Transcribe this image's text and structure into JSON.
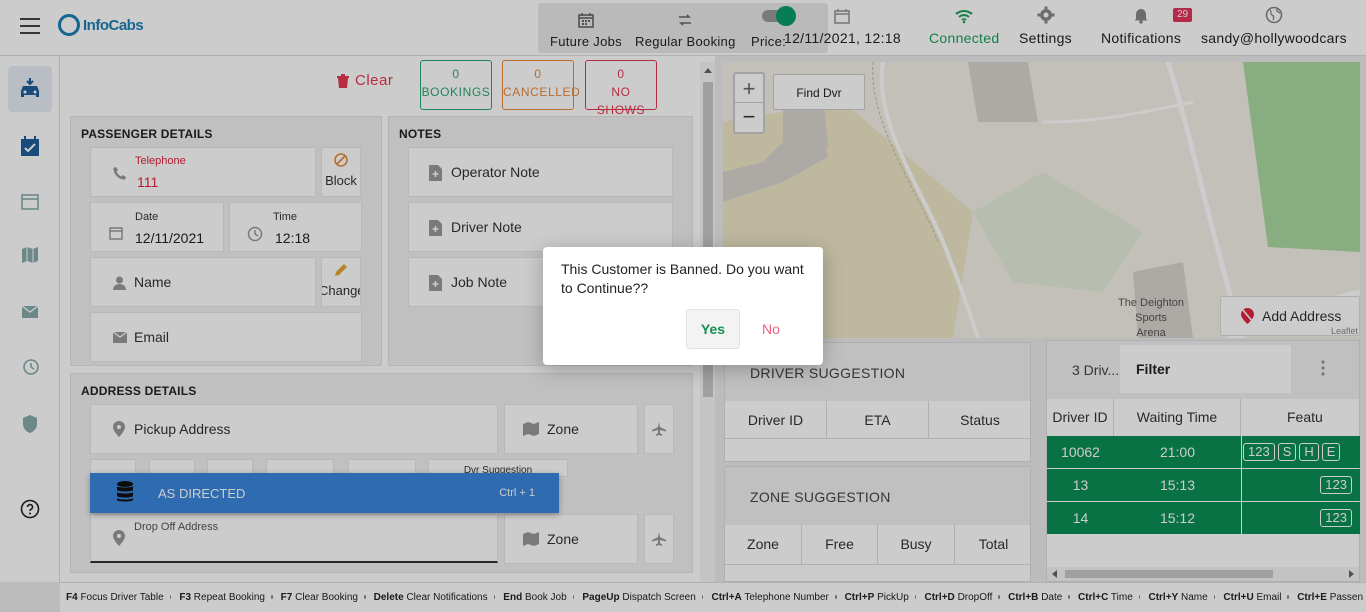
{
  "app": {
    "logo_text": "InfoCabs"
  },
  "nav": {
    "future_jobs": "Future Jobs",
    "regular_booking": "Regular Booking",
    "price_label": "Price: ",
    "datetime": "12/11/2021, 12:18",
    "connected": "Connected",
    "settings": "Settings",
    "notifications": "Notifications",
    "notifications_count": "29",
    "user": "sandy@hollywoodcars"
  },
  "toolbar": {
    "clear": "Clear"
  },
  "counters": [
    {
      "count": "0",
      "label": "BOOKINGS",
      "color": "#2aa774"
    },
    {
      "count": "0",
      "label": "CANCELLED",
      "color": "#e58a3b"
    },
    {
      "count": "0",
      "label": "NO SHOWS",
      "color": "#e53950"
    }
  ],
  "passenger": {
    "title": "PASSENGER DETAILS",
    "telephone_label": "Telephone",
    "telephone_value": "111",
    "block": "Block",
    "date_label": "Date",
    "date_value": "12/11/2021",
    "time_label": "Time",
    "time_value": "12:18",
    "name_placeholder": "Name",
    "change": "Change",
    "email_placeholder": "Email"
  },
  "notes": {
    "title": "NOTES",
    "operator": "Operator Note",
    "driver": "Driver Note",
    "job": "Job Note"
  },
  "address": {
    "title": "ADDRESS DETAILS",
    "pickup_placeholder": "Pickup Address",
    "zone": "Zone",
    "dvr_suggestion": "Dvr Suggestion",
    "dropoff_placeholder": "Drop Off Address",
    "zone2": "Zone"
  },
  "dropdown": {
    "label": "AS DIRECTED",
    "shortcut": "Ctrl + 1"
  },
  "map": {
    "find_dvr": "Find Dvr",
    "zoom_in": "+",
    "zoom_out": "−",
    "place_line1": "The Deighton",
    "place_line2": "Sports",
    "place_line3": "Arena",
    "add_address": "Add Address",
    "attribution": "Leaflet"
  },
  "driver_suggestion": {
    "title": "DRIVER SUGGESTION",
    "columns": [
      "Driver ID",
      "ETA",
      "Status"
    ]
  },
  "zone_suggestion": {
    "title": "ZONE SUGGESTION",
    "columns": [
      "Zone",
      "Free",
      "Busy",
      "Total"
    ]
  },
  "drivers_table": {
    "count_label": "3 Driv...",
    "filter": "Filter",
    "columns": [
      "Driver ID",
      "Waiting Time",
      "Featu"
    ],
    "rows": [
      {
        "id": "10062",
        "wait": "21:00",
        "features": [
          "123",
          "S",
          "H",
          "E"
        ]
      },
      {
        "id": "13",
        "wait": "15:13",
        "features": [
          "123"
        ]
      },
      {
        "id": "14",
        "wait": "15:12",
        "features": [
          "123"
        ]
      }
    ]
  },
  "shortcuts": [
    {
      "key": "F4",
      "text": "Focus Driver Table"
    },
    {
      "key": "F3",
      "text": "Repeat Booking"
    },
    {
      "key": "F7",
      "text": "Clear Booking"
    },
    {
      "key": "Delete",
      "text": "Clear Notifications"
    },
    {
      "key": "End",
      "text": "Book Job"
    },
    {
      "key": "PageUp",
      "text": "Dispatch Screen"
    },
    {
      "key": "Ctrl+A",
      "text": "Telephone Number"
    },
    {
      "key": "Ctrl+P",
      "text": "PickUp"
    },
    {
      "key": "Ctrl+D",
      "text": "DropOff"
    },
    {
      "key": "Ctrl+B",
      "text": "Date"
    },
    {
      "key": "Ctrl+C",
      "text": "Time"
    },
    {
      "key": "Ctrl+Y",
      "text": "Name"
    },
    {
      "key": "Ctrl+U",
      "text": "Email"
    },
    {
      "key": "Ctrl+E",
      "text": "Passen"
    }
  ],
  "modal": {
    "message": "This Customer is Banned. Do you want to Continue??",
    "yes": "Yes",
    "no": "No"
  }
}
